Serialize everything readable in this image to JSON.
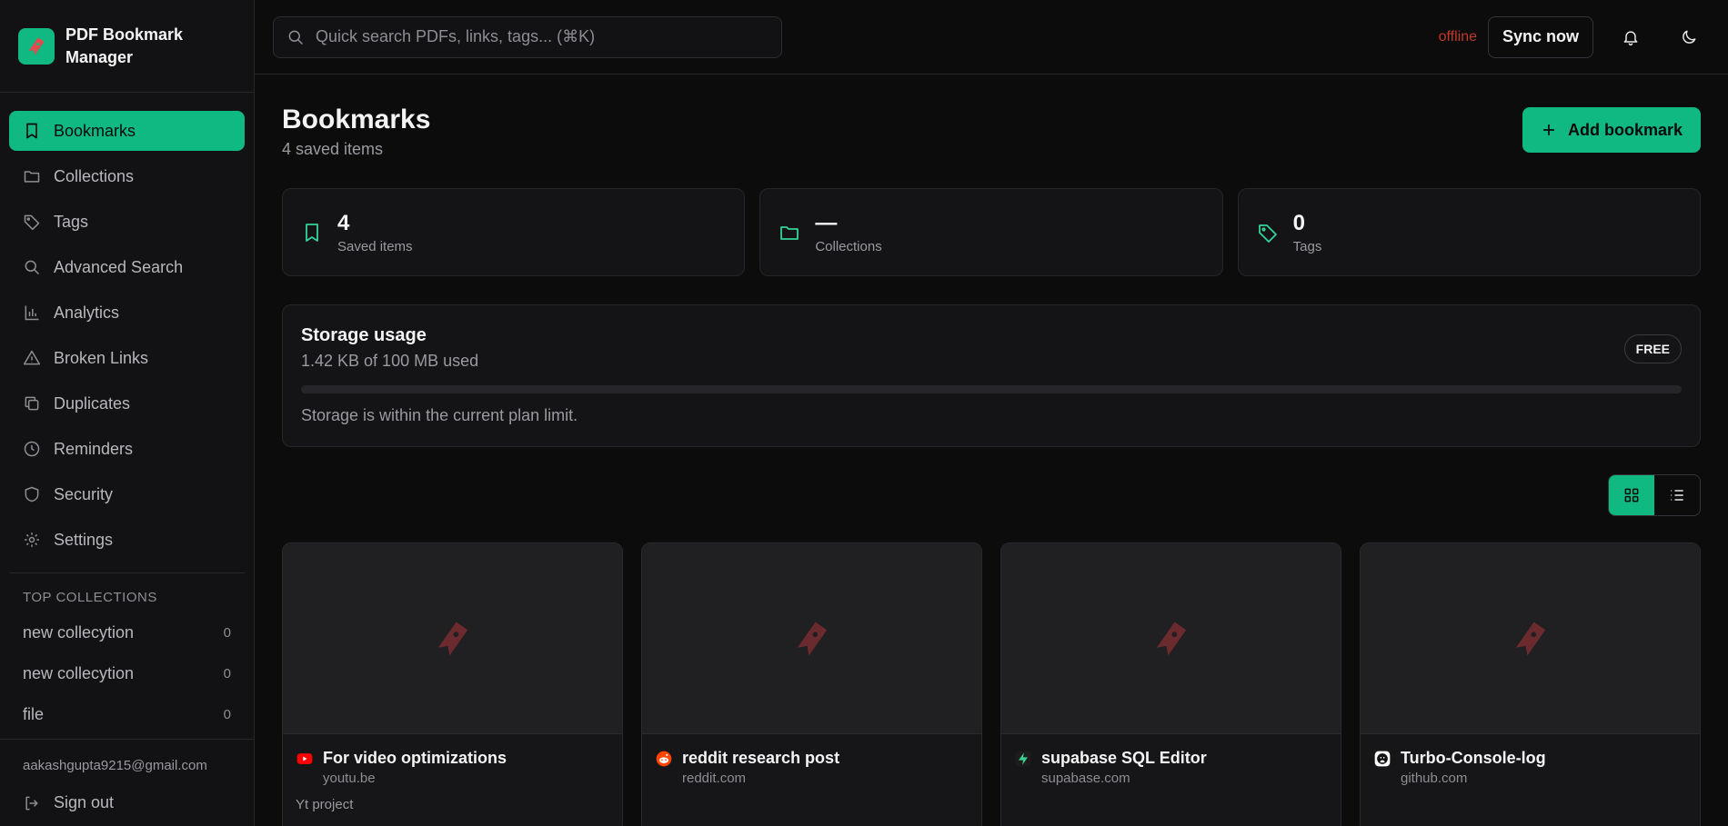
{
  "app": {
    "name": "PDF Bookmark Manager"
  },
  "sidebar": {
    "items": [
      {
        "label": "Bookmarks",
        "icon": "bookmark-icon",
        "active": true
      },
      {
        "label": "Collections",
        "icon": "folder-icon"
      },
      {
        "label": "Tags",
        "icon": "tag-icon"
      },
      {
        "label": "Advanced Search",
        "icon": "search-icon"
      },
      {
        "label": "Analytics",
        "icon": "bar-chart-icon"
      },
      {
        "label": "Broken Links",
        "icon": "warning-icon"
      },
      {
        "label": "Duplicates",
        "icon": "copy-icon"
      },
      {
        "label": "Reminders",
        "icon": "clock-icon"
      },
      {
        "label": "Security",
        "icon": "shield-icon"
      },
      {
        "label": "Settings",
        "icon": "gear-icon"
      }
    ],
    "top_collections_title": "TOP COLLECTIONS",
    "collections": [
      {
        "name": "new collecytion",
        "count": "0"
      },
      {
        "name": "new collecytion",
        "count": "0"
      },
      {
        "name": "file",
        "count": "0"
      }
    ],
    "user_email": "aakashgupta9215@gmail.com",
    "sign_out_label": "Sign out"
  },
  "topbar": {
    "search_placeholder": "Quick search PDFs, links, tags... (⌘K)",
    "status": "offline",
    "sync_label": "Sync now"
  },
  "header": {
    "title": "Bookmarks",
    "subtitle": "4 saved items",
    "add_label": "Add bookmark"
  },
  "stats": [
    {
      "value": "4",
      "label": "Saved items"
    },
    {
      "value": "—",
      "label": "Collections"
    },
    {
      "value": "0",
      "label": "Tags"
    }
  ],
  "storage": {
    "title": "Storage usage",
    "used": "1.42 KB of 100 MB used",
    "plan": "FREE",
    "percent": 0,
    "note": "Storage is within the current plan limit."
  },
  "view": {
    "mode": "grid"
  },
  "bookmarks": [
    {
      "title": "For video optimizations",
      "domain": "youtu.be",
      "note": "Yt project",
      "favicon": "youtube-icon"
    },
    {
      "title": "reddit research post",
      "domain": "reddit.com",
      "note": "",
      "favicon": "reddit-icon"
    },
    {
      "title": "supabase SQL Editor",
      "domain": "supabase.com",
      "note": "",
      "favicon": "supabase-icon"
    },
    {
      "title": "Turbo-Console-log",
      "domain": "github.com",
      "note": "",
      "favicon": "github-icon"
    }
  ],
  "colors": {
    "accent": "#10b981",
    "background": "#0c0c0d",
    "offline": "#c0392b"
  }
}
